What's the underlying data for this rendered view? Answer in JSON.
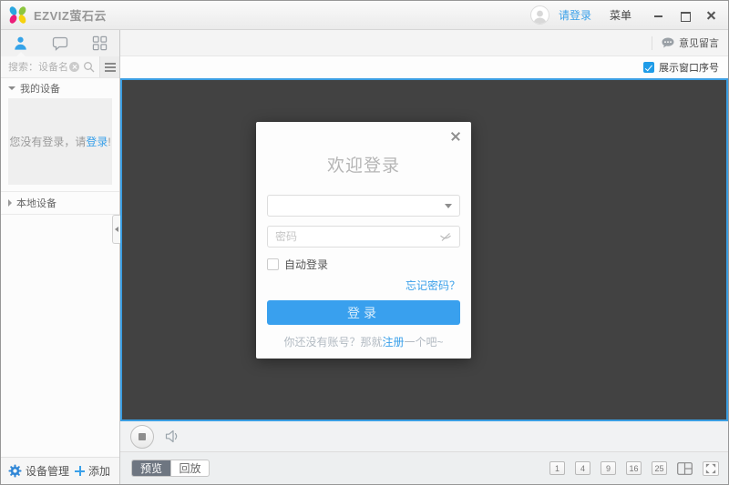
{
  "titlebar": {
    "app_name": "EZVIZ萤石云",
    "login_link": "请登录",
    "menu_label": "菜单"
  },
  "sidebar": {
    "search_placeholder": "搜索：设备名",
    "my_devices_label": "我的设备",
    "local_devices_label": "本地设备",
    "login_prompt": {
      "prefix": "您没有登录，请",
      "link": "登录",
      "suffix": "!"
    },
    "device_management_label": "设备管理",
    "add_label": "添加"
  },
  "toolbar": {
    "feedback_label": "意见留言",
    "show_window_number_label": "展示窗口序号",
    "show_window_number_checked": true
  },
  "login_dialog": {
    "title": "欢迎登录",
    "password_placeholder": "密码",
    "auto_login_label": "自动登录",
    "forgot_password_label": "忘记密码？",
    "login_button_label": "登录",
    "register_prefix": "你还没有账号？那就",
    "register_link": "注册",
    "register_suffix": "一个吧~"
  },
  "footer": {
    "preview_tab": "预览",
    "playback_tab": "回放",
    "layout_buttons": [
      "1",
      "4",
      "9",
      "16",
      "25"
    ]
  },
  "colors": {
    "accent_blue": "#3aa0e9",
    "login_button_blue": "#39a0ee",
    "checkbox_blue": "#1f9ce8",
    "video_background": "#424242",
    "selected_window_border": "#3b9ee2",
    "preview_tab_active": "#6e7681"
  }
}
